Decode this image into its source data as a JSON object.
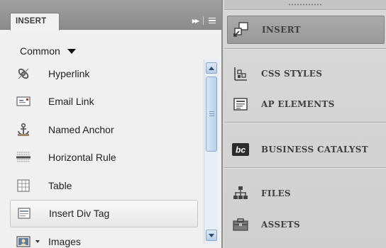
{
  "insert_panel": {
    "tab_label": "INSERT",
    "category": "Common",
    "items": [
      {
        "label": "Hyperlink",
        "icon": "hyperlink-icon"
      },
      {
        "label": "Email Link",
        "icon": "email-link-icon"
      },
      {
        "label": "Named Anchor",
        "icon": "named-anchor-icon"
      },
      {
        "label": "Horizontal Rule",
        "icon": "horizontal-rule-icon"
      },
      {
        "label": "Table",
        "icon": "table-icon"
      },
      {
        "label": "Insert Div Tag",
        "icon": "div-tag-icon",
        "selected": true
      },
      {
        "label": "Images",
        "icon": "images-icon",
        "has_dropdown": true
      }
    ]
  },
  "dock": {
    "items": [
      {
        "label": "INSERT",
        "icon": "insert-panel-icon",
        "active": true
      },
      {
        "label": "CSS STYLES",
        "icon": "css-styles-icon"
      },
      {
        "label": "AP ELEMENTS",
        "icon": "ap-elements-icon"
      },
      {
        "label": "BUSINESS CATALYST",
        "icon": "business-catalyst-icon"
      },
      {
        "label": "FILES",
        "icon": "files-icon"
      },
      {
        "label": "ASSETS",
        "icon": "assets-icon"
      }
    ]
  },
  "colors": {
    "tab_bar": "#8b8b8b",
    "panel_bg": "#f0f0f0",
    "dock_bg": "#d4d4d4",
    "scrollbar_accent": "#b6cde6"
  }
}
